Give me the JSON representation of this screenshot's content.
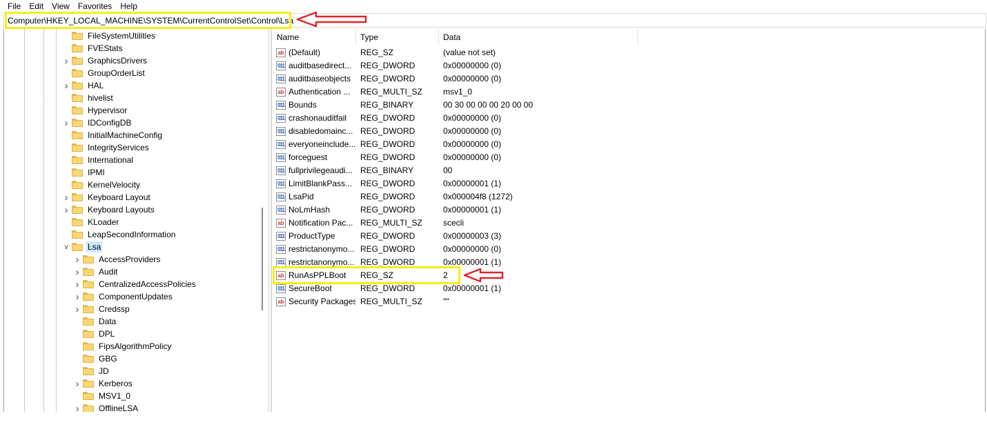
{
  "menu": [
    "File",
    "Edit",
    "View",
    "Favorites",
    "Help"
  ],
  "address": "Computer\\HKEY_LOCAL_MACHINE\\SYSTEM\\CurrentControlSet\\Control\\Lsa",
  "colors": {
    "highlight": "#f6ef14",
    "arrow": "#e0242c",
    "selection": "#cce8ff"
  },
  "tree": {
    "items": [
      {
        "label": "FileSystemUtilities",
        "expandable": false,
        "level": 1
      },
      {
        "label": "FVEStats",
        "expandable": false,
        "level": 1
      },
      {
        "label": "GraphicsDrivers",
        "expandable": true,
        "level": 1
      },
      {
        "label": "GroupOrderList",
        "expandable": false,
        "level": 1
      },
      {
        "label": "HAL",
        "expandable": true,
        "level": 1
      },
      {
        "label": "hivelist",
        "expandable": false,
        "level": 1
      },
      {
        "label": "Hypervisor",
        "expandable": false,
        "level": 1
      },
      {
        "label": "IDConfigDB",
        "expandable": true,
        "level": 1
      },
      {
        "label": "InitialMachineConfig",
        "expandable": false,
        "level": 1
      },
      {
        "label": "IntegrityServices",
        "expandable": false,
        "level": 1
      },
      {
        "label": "International",
        "expandable": false,
        "level": 1
      },
      {
        "label": "IPMI",
        "expandable": false,
        "level": 1
      },
      {
        "label": "KernelVelocity",
        "expandable": false,
        "level": 1
      },
      {
        "label": "Keyboard Layout",
        "expandable": true,
        "level": 1
      },
      {
        "label": "Keyboard Layouts",
        "expandable": true,
        "level": 1
      },
      {
        "label": "KLoader",
        "expandable": false,
        "level": 1
      },
      {
        "label": "LeapSecondInformation",
        "expandable": false,
        "level": 1
      },
      {
        "label": "Lsa",
        "expandable": true,
        "expanded": true,
        "selected": true,
        "level": 1
      },
      {
        "label": "AccessProviders",
        "expandable": true,
        "level": 2
      },
      {
        "label": "Audit",
        "expandable": true,
        "level": 2
      },
      {
        "label": "CentralizedAccessPolicies",
        "expandable": true,
        "level": 2
      },
      {
        "label": "ComponentUpdates",
        "expandable": true,
        "level": 2
      },
      {
        "label": "Credssp",
        "expandable": true,
        "level": 2
      },
      {
        "label": "Data",
        "expandable": false,
        "level": 2
      },
      {
        "label": "DPL",
        "expandable": false,
        "level": 2
      },
      {
        "label": "FipsAlgorithmPolicy",
        "expandable": false,
        "level": 2
      },
      {
        "label": "GBG",
        "expandable": false,
        "level": 2
      },
      {
        "label": "JD",
        "expandable": false,
        "level": 2
      },
      {
        "label": "Kerberos",
        "expandable": true,
        "level": 2
      },
      {
        "label": "MSV1_0",
        "expandable": false,
        "level": 2
      },
      {
        "label": "OfflineLSA",
        "expandable": true,
        "level": 2
      }
    ]
  },
  "list": {
    "columns": [
      "Name",
      "Type",
      "Data"
    ],
    "rows": [
      {
        "name": "(Default)",
        "type": "REG_SZ",
        "data": "(value not set)",
        "icon": "string-value-icon"
      },
      {
        "name": "auditbasedirect...",
        "type": "REG_DWORD",
        "data": "0x00000000 (0)",
        "icon": "binary-value-icon"
      },
      {
        "name": "auditbaseobjects",
        "type": "REG_DWORD",
        "data": "0x00000000 (0)",
        "icon": "binary-value-icon"
      },
      {
        "name": "Authentication ...",
        "type": "REG_MULTI_SZ",
        "data": "msv1_0",
        "icon": "string-value-icon"
      },
      {
        "name": "Bounds",
        "type": "REG_BINARY",
        "data": "00 30 00 00 00 20 00 00",
        "icon": "binary-value-icon"
      },
      {
        "name": "crashonauditfail",
        "type": "REG_DWORD",
        "data": "0x00000000 (0)",
        "icon": "binary-value-icon"
      },
      {
        "name": "disabledomainc...",
        "type": "REG_DWORD",
        "data": "0x00000000 (0)",
        "icon": "binary-value-icon"
      },
      {
        "name": "everyoneinclude...",
        "type": "REG_DWORD",
        "data": "0x00000000 (0)",
        "icon": "binary-value-icon"
      },
      {
        "name": "forceguest",
        "type": "REG_DWORD",
        "data": "0x00000000 (0)",
        "icon": "binary-value-icon"
      },
      {
        "name": "fullprivilegeaudi...",
        "type": "REG_BINARY",
        "data": "00",
        "icon": "binary-value-icon"
      },
      {
        "name": "LimitBlankPass...",
        "type": "REG_DWORD",
        "data": "0x00000001 (1)",
        "icon": "binary-value-icon"
      },
      {
        "name": "LsaPid",
        "type": "REG_DWORD",
        "data": "0x000004f8 (1272)",
        "icon": "binary-value-icon"
      },
      {
        "name": "NoLmHash",
        "type": "REG_DWORD",
        "data": "0x00000001 (1)",
        "icon": "binary-value-icon"
      },
      {
        "name": "Notification Pac...",
        "type": "REG_MULTI_SZ",
        "data": "scecli",
        "icon": "string-value-icon"
      },
      {
        "name": "ProductType",
        "type": "REG_DWORD",
        "data": "0x00000003 (3)",
        "icon": "binary-value-icon"
      },
      {
        "name": "restrictanonymo...",
        "type": "REG_DWORD",
        "data": "0x00000000 (0)",
        "icon": "binary-value-icon"
      },
      {
        "name": "restrictanonymo...",
        "type": "REG_DWORD",
        "data": "0x00000001 (1)",
        "icon": "binary-value-icon"
      },
      {
        "name": "RunAsPPLBoot",
        "type": "REG_SZ",
        "data": "2",
        "icon": "string-value-icon",
        "highlighted": true
      },
      {
        "name": "SecureBoot",
        "type": "REG_DWORD",
        "data": "0x00000001 (1)",
        "icon": "binary-value-icon"
      },
      {
        "name": "Security Packages",
        "type": "REG_MULTI_SZ",
        "data": "\"\"",
        "icon": "string-value-icon"
      }
    ]
  }
}
